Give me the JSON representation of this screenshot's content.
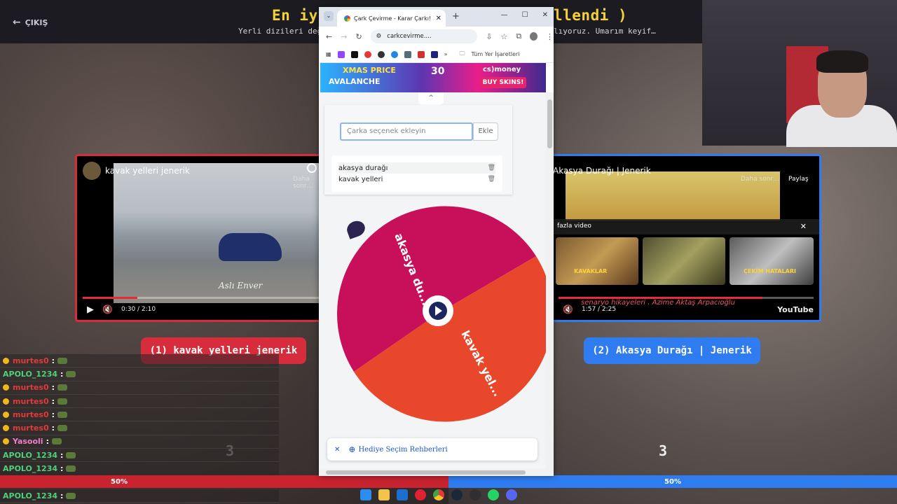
{
  "header": {
    "exit_label": "ÇIKIŞ",
    "title": "En iyi",
    "title_tail": "llendi )",
    "subtitle": "Yerli dizileri değ",
    "subtitle_tail": "lıyoruz. Umarım keyif…"
  },
  "browser": {
    "tab_title": "Çark Çevirme - Karar Çarkı!",
    "url": "carkcevirme....",
    "bookmarks_folder": "Tüm Yer İşaretleri",
    "ad": {
      "line1": "XMAS PRICE",
      "line2": "AVALANCHE",
      "promo": "30",
      "brand": "cs)money",
      "cta": "BUY SKINS!"
    },
    "wheel_input_placeholder": "Çarka seçenek ekleyin",
    "add_button": "Ekle",
    "options": [
      "akasya durağı",
      "kavak yelleri"
    ],
    "wheel_labels": [
      "akasya du...",
      "kavak yel..."
    ],
    "gift_label": "Hediye Seçim Rehberleri"
  },
  "left_video": {
    "title": "kavak yelleri jenerik",
    "time": "0:30 / 2:10",
    "later": "Daha sonr…",
    "watermark": "Aslı Enver",
    "progress": 0.23
  },
  "right_video": {
    "title": "Akasya Durağı | Jenerik",
    "time": "1:57 / 2:25",
    "later": "Daha sonr…",
    "share": "Paylaş",
    "more_videos": "fazla video",
    "subtitle": "senaryo hikayeleri . Azime Aktaş Arpacıoğlu",
    "youtube": "YouTube",
    "thumb_caption1": "KAVAKLAR",
    "thumb_caption3": "ÇEKİM HATALARI",
    "progress": 0.8
  },
  "choices": {
    "left_label": "(1) kavak yelleri jenerik",
    "right_label": "(2) Akasya Durağı | Jenerik",
    "left_count": "3",
    "right_count": "3",
    "left_pct": "50%",
    "right_pct": "50%"
  },
  "chat": [
    {
      "user": "murtes0",
      "color": "#e03a3a",
      "badge": true
    },
    {
      "user": "APOLO_1234",
      "color": "#4fd07a",
      "badge": false
    },
    {
      "user": "murtes0",
      "color": "#e03a3a",
      "badge": true
    },
    {
      "user": "murtes0",
      "color": "#e03a3a",
      "badge": true
    },
    {
      "user": "murtes0",
      "color": "#e03a3a",
      "badge": true
    },
    {
      "user": "murtes0",
      "color": "#e03a3a",
      "badge": true
    },
    {
      "user": "Yasooli",
      "color": "#f07ec8",
      "badge": true
    },
    {
      "user": "APOLO_1234",
      "color": "#4fd07a",
      "badge": false
    },
    {
      "user": "APOLO_1234",
      "color": "#4fd07a",
      "badge": false
    },
    {
      "user": "APOLO_1234",
      "color": "#4fd07a",
      "badge": false
    },
    {
      "user": "APOLO_1234",
      "color": "#4fd07a",
      "badge": false
    }
  ],
  "colors": {
    "left_accent": "#d72c3c",
    "right_accent": "#2f7cf0",
    "title_yellow": "#f4d23a",
    "wheel_slice_a": "#c8105a",
    "wheel_slice_b": "#e8472c"
  }
}
